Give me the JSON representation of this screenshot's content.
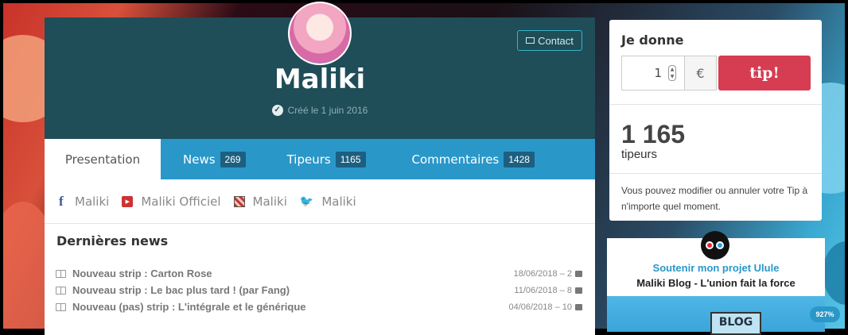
{
  "header": {
    "contact_label": "Contact",
    "name": "Maliki",
    "created": "Créé le 1 juin 2016"
  },
  "tabs": [
    {
      "label": "Presentation",
      "count": ""
    },
    {
      "label": "News",
      "count": "269"
    },
    {
      "label": "Tipeurs",
      "count": "1165"
    },
    {
      "label": "Commentaires",
      "count": "1428"
    }
  ],
  "socials": [
    {
      "icon": "facebook-icon",
      "label": "Maliki"
    },
    {
      "icon": "youtube-icon",
      "label": "Maliki Officiel"
    },
    {
      "icon": "tapas-icon",
      "label": "Maliki"
    },
    {
      "icon": "twitter-icon",
      "label": "Maliki"
    }
  ],
  "news": {
    "title": "Dernières news",
    "items": [
      {
        "title": "Nouveau strip : Carton Rose",
        "date": "18/06/2018 – 2"
      },
      {
        "title": "Nouveau strip : Le bac plus tard ! (par Fang)",
        "date": "11/06/2018 – 8"
      },
      {
        "title": "Nouveau (pas) strip : L'intégrale et le générique",
        "date": "04/06/2018 – 10"
      }
    ]
  },
  "tip": {
    "title": "Je donne",
    "amount": "1",
    "currency": "€",
    "button": "tip!",
    "count": "1 165",
    "count_label": "tipeurs",
    "note": "Vous pouvez modifier ou annuler votre Tip à n'importe quel moment."
  },
  "ulule": {
    "line1": "Soutenir mon projet Ulule",
    "line2": "Maliki Blog - L'union fait la force",
    "banner_text": "BLOG",
    "badge": "927%"
  },
  "colors": {
    "header_bg": "#1f4d58",
    "tabs_bg": "#2a97c9",
    "tip_button": "#d63d52"
  }
}
